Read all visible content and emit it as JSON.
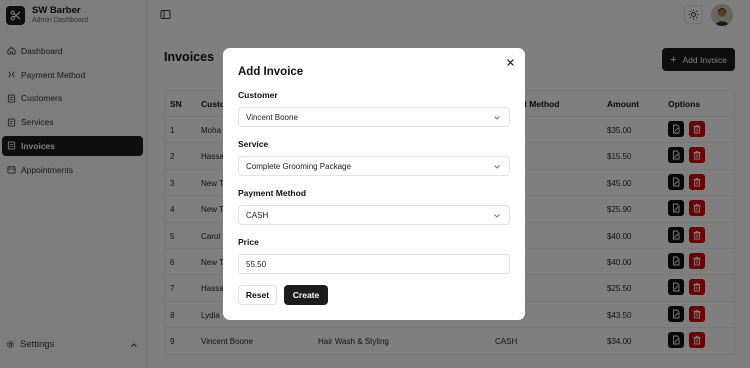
{
  "brand": {
    "name": "SW Barber",
    "subtitle": "Admin Dashboard"
  },
  "sidebar": {
    "items": [
      {
        "label": "Dashboard",
        "icon": "home-icon",
        "active": false
      },
      {
        "label": "Payment Method",
        "icon": "payment-icon",
        "active": false
      },
      {
        "label": "Customers",
        "icon": "customers-icon",
        "active": false
      },
      {
        "label": "Services",
        "icon": "services-icon",
        "active": false
      },
      {
        "label": "Invoices",
        "icon": "invoice-icon",
        "active": true
      },
      {
        "label": "Appointments",
        "icon": "calendar-icon",
        "active": false
      }
    ],
    "settings_label": "Settings"
  },
  "page": {
    "title": "Invoices",
    "add_button_label": "Add Invoice"
  },
  "table": {
    "headers": {
      "sn": "SN",
      "customer": "Custom",
      "service": "",
      "payment": "t Method",
      "amount": "Amount",
      "options": "Options"
    },
    "rows": [
      {
        "sn": "1",
        "customer": "Moha",
        "service": "",
        "payment": "",
        "amount": "$35.00"
      },
      {
        "sn": "2",
        "customer": "Hassa",
        "service": "",
        "payment": "",
        "amount": "$15.50"
      },
      {
        "sn": "3",
        "customer": "New T",
        "service": "",
        "payment": "",
        "amount": "$45.00"
      },
      {
        "sn": "4",
        "customer": "New T",
        "service": "",
        "payment": "",
        "amount": "$25.90"
      },
      {
        "sn": "5",
        "customer": "Carol",
        "service": "",
        "payment": "",
        "amount": "$40.00"
      },
      {
        "sn": "6",
        "customer": "New T",
        "service": "",
        "payment": "",
        "amount": "$40.00"
      },
      {
        "sn": "7",
        "customer": "Hassa",
        "service": "",
        "payment": "",
        "amount": "$25.50"
      },
      {
        "sn": "8",
        "customer": "Lydia",
        "service": "",
        "payment": "",
        "amount": "$43.50"
      },
      {
        "sn": "9",
        "customer": "Vincent Boone",
        "service": "Hair Wash & Styling",
        "payment": "CASH",
        "amount": "$34.00"
      }
    ]
  },
  "modal": {
    "title": "Add Invoice",
    "customer_label": "Customer",
    "customer_value": "Vincent Boone",
    "service_label": "Service",
    "service_value": "Complete Grooming Package",
    "payment_label": "Payment Method",
    "payment_value": "CASH",
    "price_label": "Price",
    "price_value": "55.50",
    "reset_label": "Reset",
    "create_label": "Create"
  },
  "colors": {
    "accent": "#1c1c1c",
    "danger": "#d40000",
    "overlay": "rgba(0,0,0,0.5)"
  }
}
